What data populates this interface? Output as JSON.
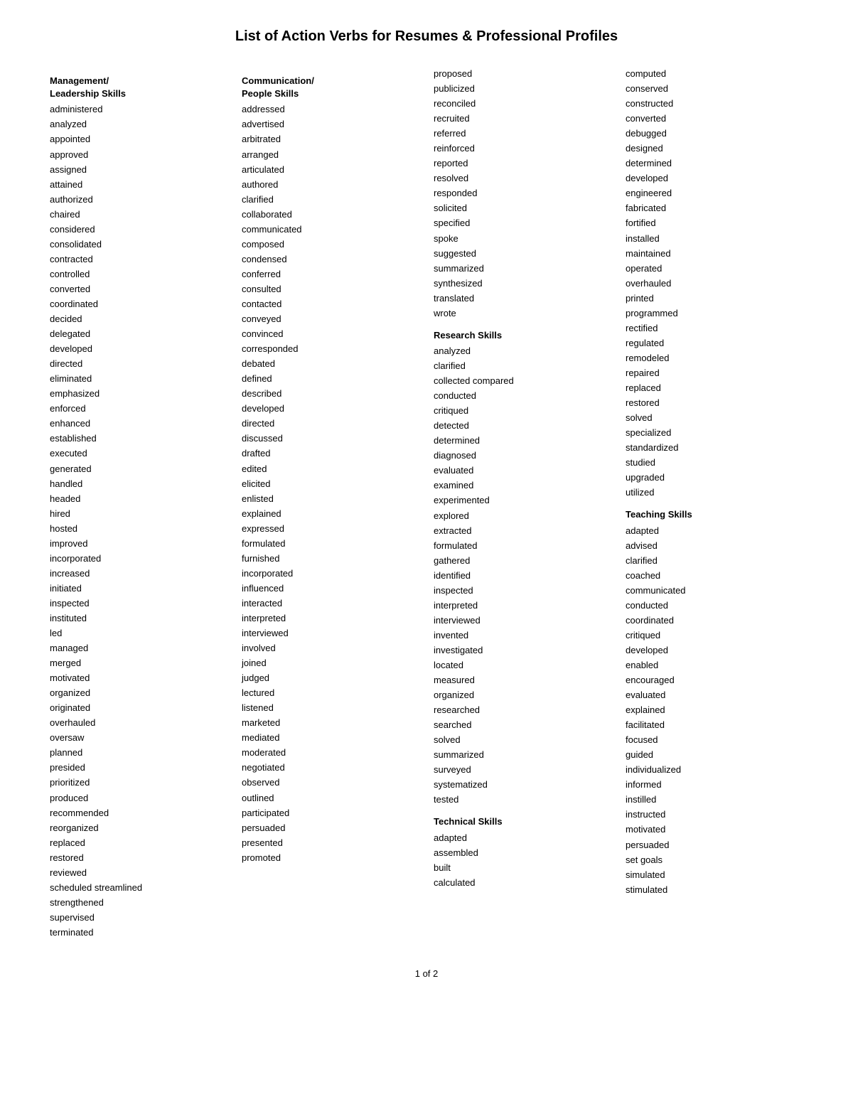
{
  "title": "List of Action Verbs for Resumes & Professional Profiles",
  "footer": "1 of 2",
  "columns": [
    {
      "sections": [
        {
          "header": "Management/\nLeadership Skills",
          "words": [
            "administered",
            "analyzed",
            "appointed",
            "approved",
            "assigned",
            "attained",
            "authorized",
            "chaired",
            "considered",
            "consolidated",
            "contracted",
            "controlled",
            "converted",
            "coordinated",
            "decided",
            "delegated",
            "developed",
            "directed",
            "eliminated",
            "emphasized",
            "enforced",
            "enhanced",
            "established",
            "executed",
            "generated",
            "handled",
            "headed",
            "hired",
            "hosted",
            "improved",
            "incorporated",
            "increased",
            "initiated",
            "inspected",
            "instituted",
            "led",
            "managed",
            "merged",
            "motivated",
            "organized",
            "originated",
            "overhauled",
            "oversaw",
            "planned",
            "presided",
            "prioritized",
            "produced",
            "recommended",
            "reorganized",
            "replaced",
            "restored",
            "reviewed",
            "scheduled streamlined",
            "strengthened"
          ]
        },
        {
          "header": null,
          "words": [
            "supervised",
            "terminated"
          ]
        }
      ]
    },
    {
      "sections": [
        {
          "header": "Communication/\nPeople Skills",
          "words": [
            "addressed",
            "advertised",
            "arbitrated",
            "arranged",
            "articulated",
            "authored",
            "clarified",
            "collaborated",
            "communicated",
            "composed",
            "condensed",
            "conferred",
            "consulted",
            "contacted",
            "conveyed",
            "convinced",
            "corresponded",
            "debated",
            "defined",
            "described",
            "developed",
            "directed",
            "discussed",
            "drafted",
            "edited",
            "elicited",
            "enlisted",
            "explained",
            "expressed",
            "formulated",
            "furnished",
            "incorporated",
            "influenced",
            "interacted",
            "interpreted",
            "interviewed",
            "involved",
            "joined",
            "judged",
            "lectured",
            "listened",
            "marketed",
            "mediated",
            "moderated",
            "negotiated",
            "observed",
            "outlined",
            "participated",
            "persuaded",
            "presented",
            "promoted"
          ]
        }
      ]
    },
    {
      "sections": [
        {
          "header": null,
          "words": [
            "proposed",
            "publicized",
            "reconciled",
            "recruited",
            "referred",
            "reinforced",
            "reported",
            "resolved",
            "responded",
            "solicited",
            "specified",
            "spoke",
            "suggested",
            "summarized",
            "synthesized",
            "translated",
            "wrote"
          ]
        },
        {
          "header": "Research Skills",
          "words": [
            "analyzed",
            "clarified",
            "collected compared",
            "conducted",
            "critiqued",
            "detected",
            "determined",
            "diagnosed",
            "evaluated",
            "examined",
            "experimented",
            "explored",
            "extracted",
            "formulated",
            "gathered",
            "identified",
            "inspected",
            "interpreted",
            "interviewed",
            "invented",
            "investigated",
            "located",
            "measured",
            "organized",
            "researched",
            "searched",
            "solved",
            "summarized",
            "surveyed",
            "systematized",
            "tested"
          ]
        },
        {
          "header": "Technical Skills",
          "words": [
            "adapted",
            "assembled",
            "built",
            "calculated"
          ]
        }
      ]
    },
    {
      "sections": [
        {
          "header": null,
          "words": [
            "computed",
            "conserved",
            "constructed",
            "converted",
            "debugged",
            "designed",
            "determined",
            "developed",
            "engineered",
            "fabricated",
            "fortified",
            "installed",
            "maintained",
            "operated",
            "overhauled",
            "printed",
            "programmed",
            "rectified",
            "regulated",
            "remodeled",
            "repaired",
            "replaced",
            "restored",
            "solved",
            "specialized",
            "standardized",
            "studied",
            "upgraded",
            "utilized"
          ]
        },
        {
          "header": "Teaching Skills",
          "words": [
            "adapted",
            "advised",
            "clarified",
            "coached",
            "communicated",
            "conducted",
            "coordinated",
            "critiqued",
            "developed",
            "enabled",
            "encouraged",
            "evaluated",
            "explained",
            "facilitated",
            "focused",
            "guided",
            "individualized",
            "informed",
            "instilled",
            "instructed",
            "motivated",
            "persuaded",
            "set goals",
            "simulated",
            "stimulated"
          ]
        }
      ]
    }
  ]
}
